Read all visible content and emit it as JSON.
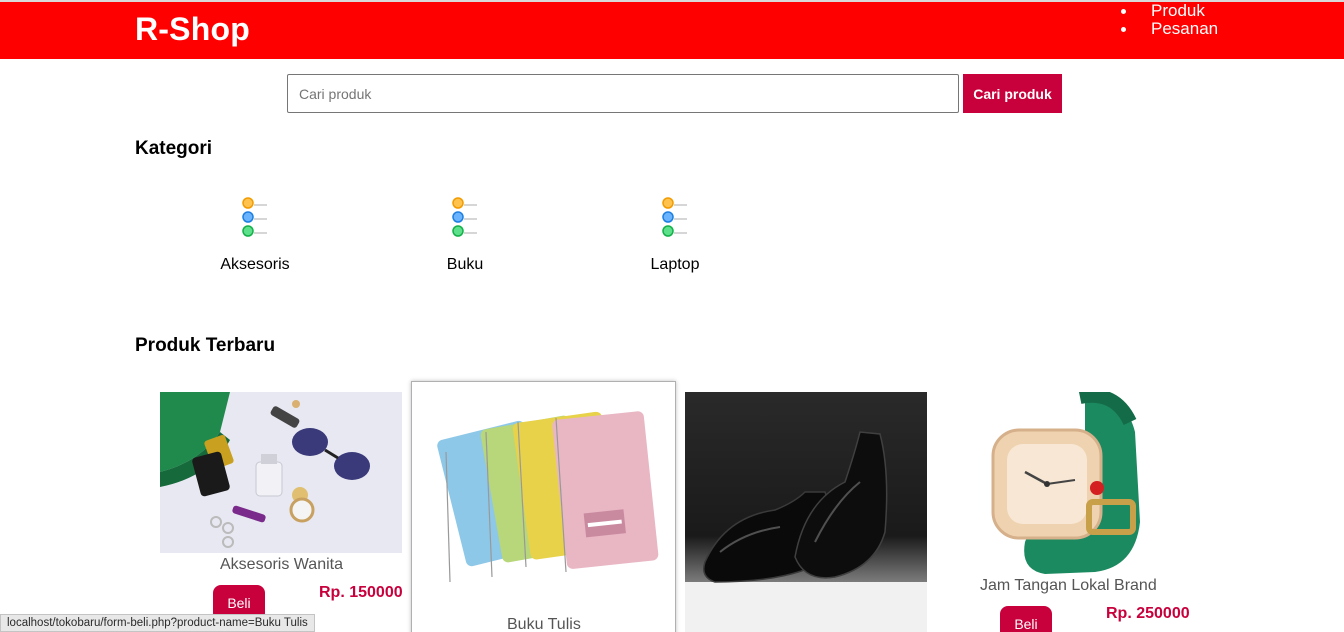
{
  "header": {
    "brand": "R-Shop",
    "nav": [
      "Produk",
      "Pesanan"
    ]
  },
  "search": {
    "placeholder": "Cari produk",
    "value": "",
    "button_label": "Cari produk"
  },
  "categories": {
    "title": "Kategori",
    "items": [
      {
        "label": "Aksesoris",
        "icon": "list-icon"
      },
      {
        "label": "Buku",
        "icon": "list-icon"
      },
      {
        "label": "Laptop",
        "icon": "list-icon"
      }
    ]
  },
  "products": {
    "title": "Produk Terbaru",
    "items": [
      {
        "name": "Aksesoris Wanita",
        "price": "Rp. 150000",
        "buy_label": "Beli",
        "image": "accessories-photo"
      },
      {
        "name": "Buku Tulis",
        "price": "",
        "buy_label": "",
        "image": "notebooks-photo"
      },
      {
        "name": "",
        "price": "",
        "buy_label": "",
        "image": "shoes-photo"
      },
      {
        "name": "Jam Tangan Lokal Brand",
        "price": "Rp. 250000",
        "buy_label": "Beli",
        "image": "watch-photo"
      }
    ]
  },
  "status_bar": {
    "url": "localhost/tokobaru/form-beli.php?product-name=Buku Tulis"
  },
  "colors": {
    "header": "#ff0000",
    "accent": "#c8003c"
  }
}
